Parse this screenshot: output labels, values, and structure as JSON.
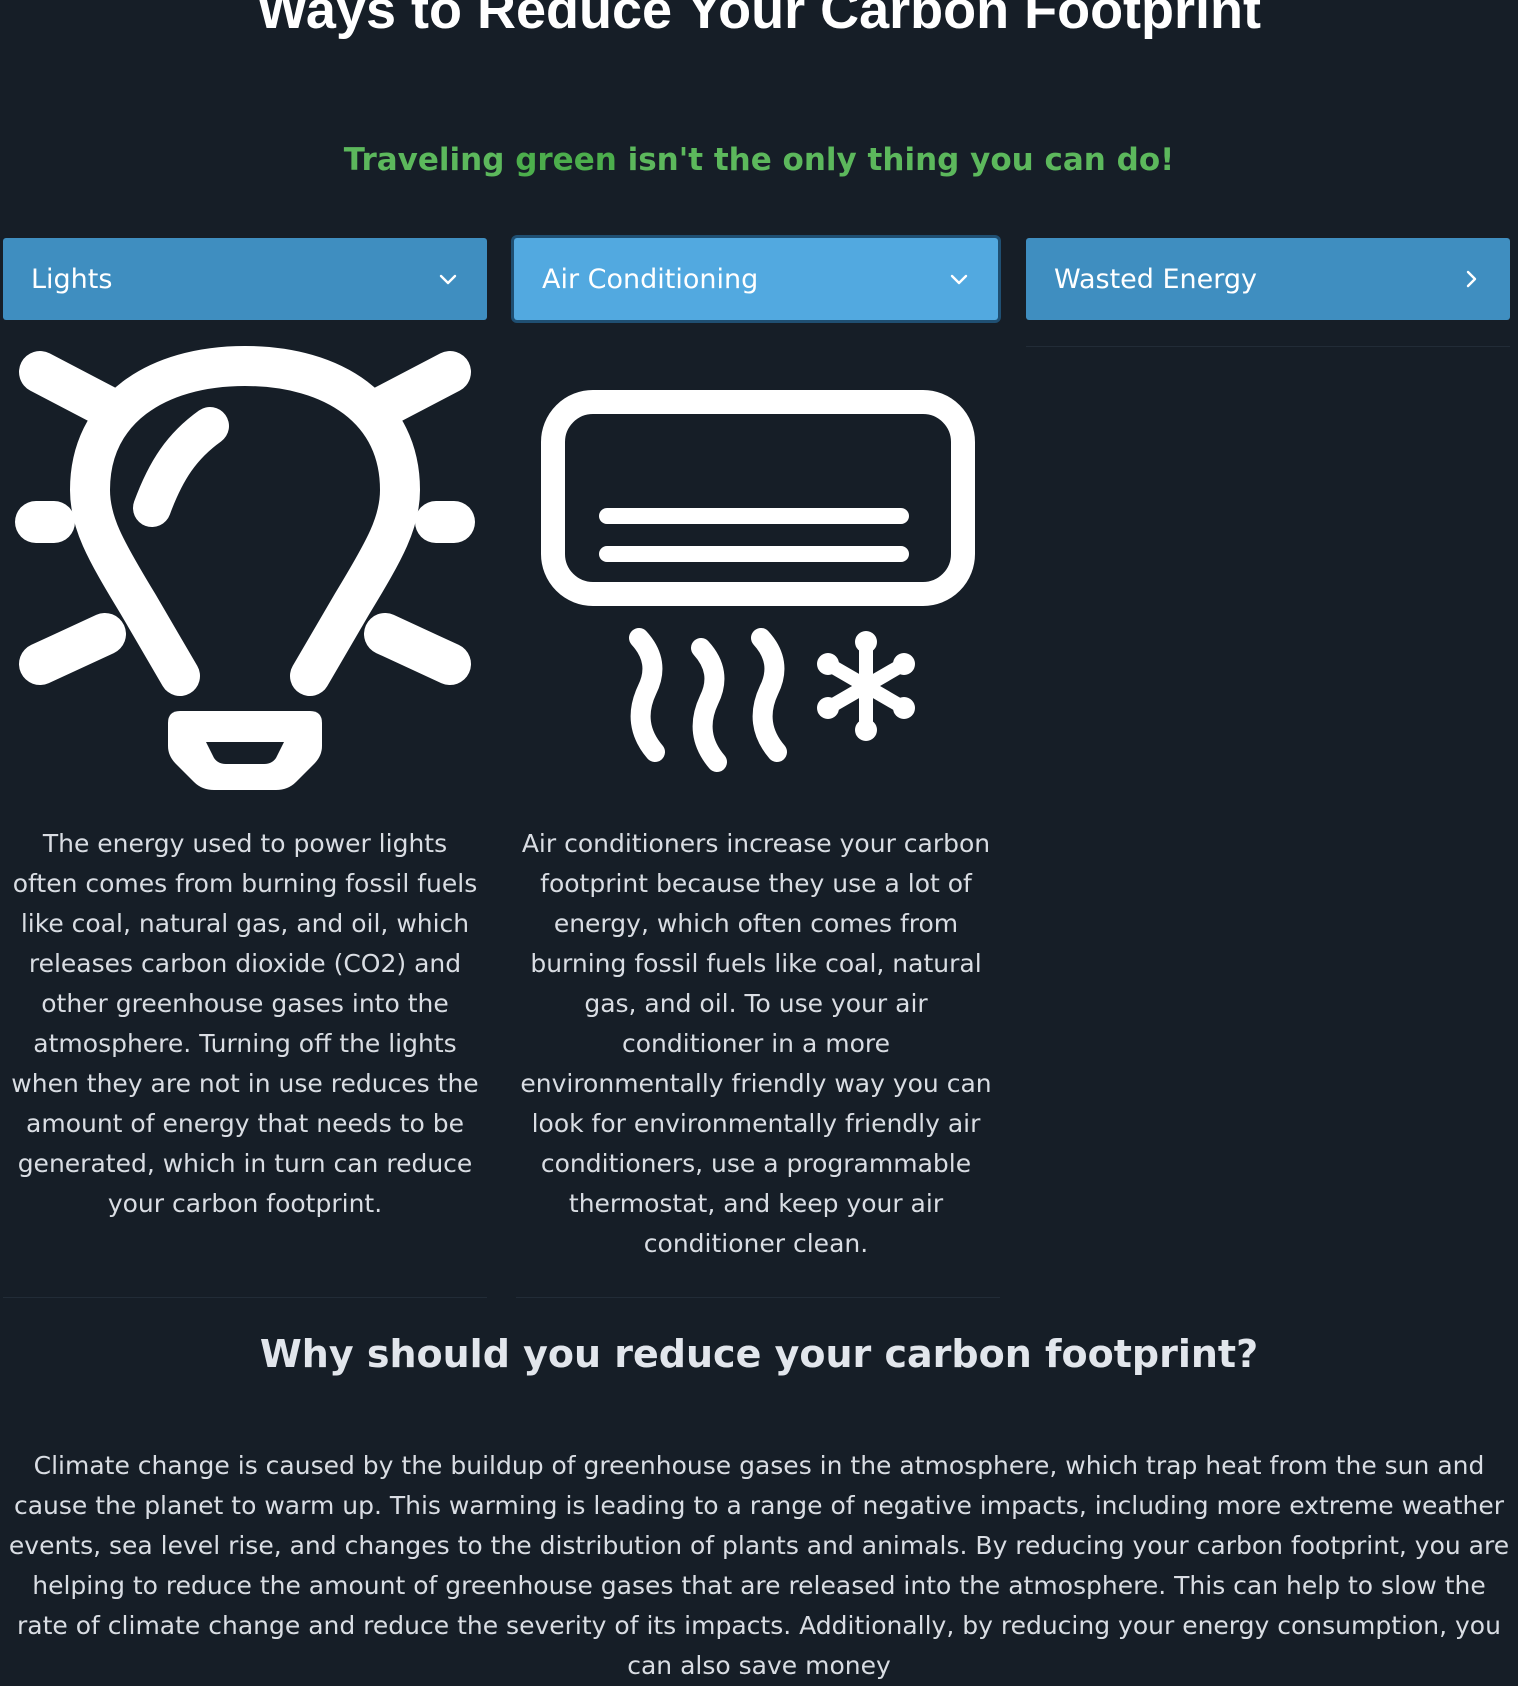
{
  "header": {
    "title": "Ways to Reduce Your Carbon Footprint",
    "subtitle_pre": "Traveling ",
    "subtitle_strong": "green",
    "subtitle_post": " isn't the only thing you can do!"
  },
  "accordion": [
    {
      "label": "Lights",
      "expanded": true,
      "icon": "lightbulb-icon",
      "text": "The energy used to power lights often comes from burning fossil fuels like coal, natural gas, and oil, which releases carbon dioxide (CO2) and other greenhouse gases into the atmosphere. Turning off the lights when they are not in use reduces the amount of energy that needs to be generated, which in turn can reduce your carbon footprint."
    },
    {
      "label": "Air Conditioning",
      "expanded": true,
      "icon": "air-conditioner-icon",
      "text": "Air conditioners increase your carbon footprint because they use a lot of energy, which often comes from burning fossil fuels like coal, natural gas, and oil. To use your air conditioner in a more environmentally friendly way you can look for environmentally friendly air conditioners, use a programmable thermostat, and keep your air conditioner clean."
    },
    {
      "label": "Wasted Energy",
      "expanded": false,
      "icon": "chevron-right-icon"
    }
  ],
  "why": {
    "title": "Why should you reduce your carbon footprint?",
    "text": "Climate change is caused by the buildup of greenhouse gases in the atmosphere, which trap heat from the sun and cause the planet to warm up. This warming is leading to a range of negative impacts, including more extreme weather events, sea level rise, and changes to the distribution of plants and animals. By reducing your carbon footprint, you are helping to reduce the amount of greenhouse gases that are released into the atmosphere. This can help to slow the rate of climate change and reduce the severity of its impacts. Additionally, by reducing your energy consumption, you can also save money"
  },
  "colors": {
    "background": "#161e27",
    "accordion_header": "#3f8ec0",
    "accordion_header_active": "#52a9e0",
    "subtitle_green": "#5cb85c"
  }
}
